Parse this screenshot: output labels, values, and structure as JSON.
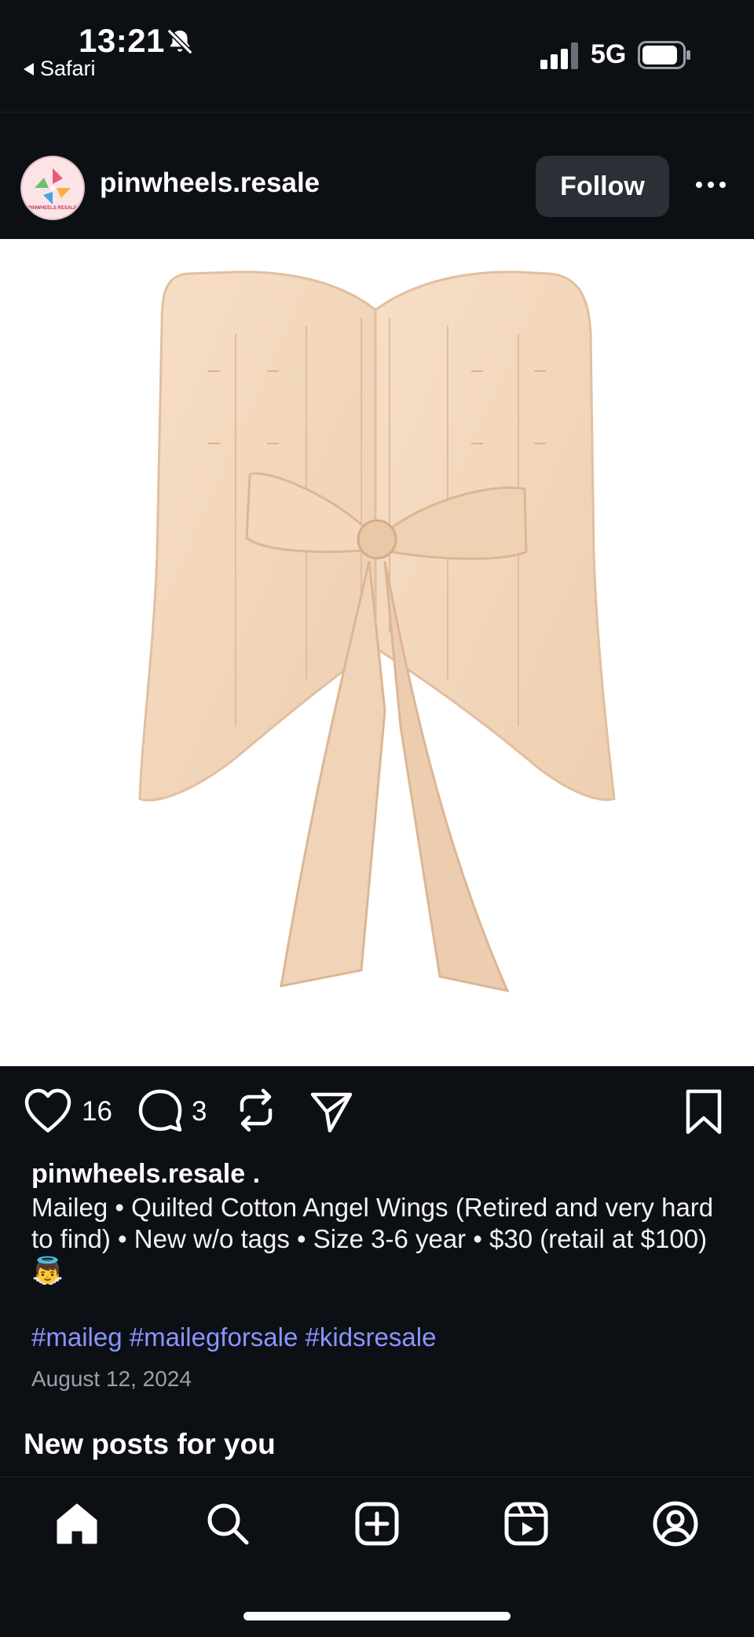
{
  "status_bar": {
    "time": "13:21",
    "back_app": "Safari",
    "network": "5G"
  },
  "post": {
    "username": "pinwheels.resale",
    "follow_label": "Follow",
    "avatar_text": "PINWHEELS RESALE",
    "like_count": "16",
    "comment_count": "3",
    "caption_user": "pinwheels.resale .",
    "caption_text": "Maileg • Quilted Cotton Angel Wings (Retired and very hard to find) • New w/o tags • Size 3-6 year • $30 (retail at $100)👼",
    "hashtags": "#maileg #mailegforsale #kidsresale",
    "date": "August 12, 2024"
  },
  "section_title": "New posts for you",
  "icons": {
    "like": "heart-icon",
    "comment": "comment-icon",
    "repost": "repost-icon",
    "share": "send-icon",
    "save": "bookmark-icon",
    "more": "more-horizontal-icon"
  },
  "tab_bar": [
    "home-icon",
    "search-icon",
    "create-icon",
    "reels-icon",
    "profile-icon"
  ],
  "colors": {
    "background": "#0c0f14",
    "hashtag": "#8a95ff",
    "follow_button": "#2b2f36",
    "product": "#f3d7bd"
  }
}
